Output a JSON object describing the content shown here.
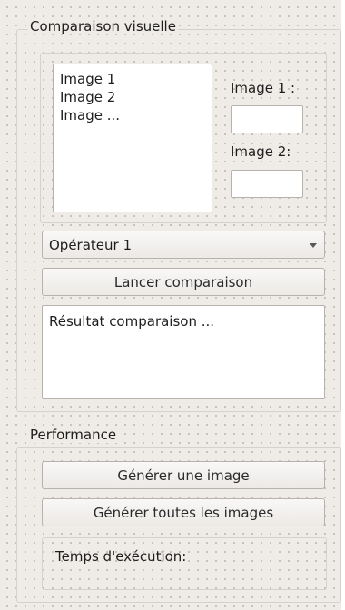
{
  "comparison": {
    "group_title": "Comparaison visuelle",
    "image_list": [
      "Image 1",
      "Image 2",
      "Image ..."
    ],
    "image1_label": "Image 1 :",
    "image1_value": "",
    "image2_label": "Image 2:",
    "image2_value": "",
    "operator_selected": "Opérateur 1",
    "launch_label": "Lancer comparaison",
    "result_text": "Résultat comparaison ..."
  },
  "performance": {
    "group_title": "Performance",
    "generate_one_label": "Générer une image",
    "generate_all_label": "Générer toutes les images",
    "exec_time_label": "Temps d'exécution:"
  },
  "icons": {
    "combo_arrow": "chevron-down-icon"
  }
}
